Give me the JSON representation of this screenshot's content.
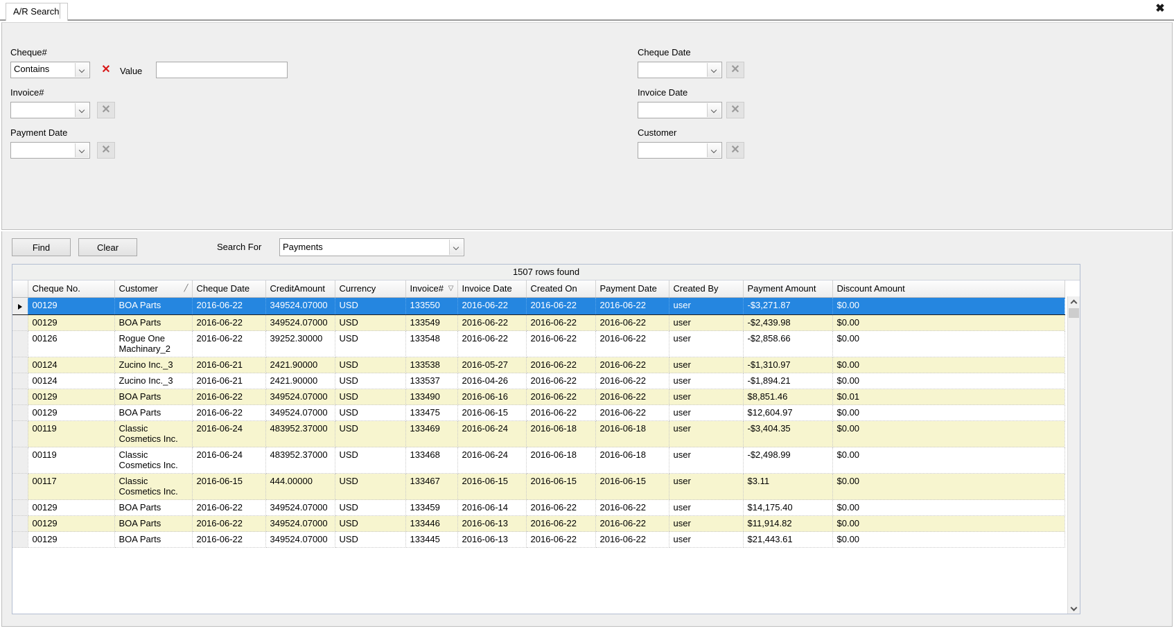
{
  "window": {
    "tab_label": "A/R Search",
    "close_icon": "close-icon",
    "close_glyph": "✖"
  },
  "criteria": {
    "cheque_no": {
      "label": "Cheque#",
      "operator_value": "Contains",
      "clear_glyph": "✕",
      "value_label": "Value",
      "value_text": "",
      "value_placeholder": ""
    },
    "invoice_no": {
      "label": "Invoice#",
      "operator_value": "",
      "clear_glyph": "✕"
    },
    "payment_date": {
      "label": "Payment Date",
      "operator_value": "",
      "clear_glyph": "✕"
    },
    "cheque_date": {
      "label": "Cheque Date",
      "operator_value": "",
      "clear_glyph": "✕"
    },
    "invoice_date": {
      "label": "Invoice Date",
      "operator_value": "",
      "clear_glyph": "✕"
    },
    "customer": {
      "label": "Customer",
      "operator_value": "",
      "clear_glyph": "✕"
    }
  },
  "actions": {
    "find_label": "Find",
    "clear_label": "Clear",
    "search_for_label": "Search For",
    "search_for_value": "Payments"
  },
  "grid": {
    "rows_found_text": "1507 rows found",
    "columns": [
      {
        "label": "Cheque No.",
        "sort": ""
      },
      {
        "label": "Customer",
        "sort": "╱"
      },
      {
        "label": "Cheque Date",
        "sort": ""
      },
      {
        "label": "CreditAmount",
        "sort": ""
      },
      {
        "label": "Currency",
        "sort": ""
      },
      {
        "label": "Invoice#",
        "sort": "▽"
      },
      {
        "label": "Invoice Date",
        "sort": ""
      },
      {
        "label": "Created On",
        "sort": ""
      },
      {
        "label": "Payment Date",
        "sort": ""
      },
      {
        "label": "Created By",
        "sort": ""
      },
      {
        "label": "Payment Amount",
        "sort": ""
      },
      {
        "label": "Discount Amount",
        "sort": ""
      }
    ],
    "rows": [
      {
        "selected": true,
        "cheque_no": "00129",
        "customer": "BOA Parts",
        "cheque_date": "2016-06-22",
        "credit_amount": "349524.07000",
        "currency": "USD",
        "invoice_no": "133550",
        "invoice_date": "2016-06-22",
        "created_on": "2016-06-22",
        "payment_date": "2016-06-22",
        "created_by": "user",
        "payment_amount": "-$3,271.87",
        "discount_amount": "$0.00"
      },
      {
        "selected": false,
        "cheque_no": "00129",
        "customer": "BOA Parts",
        "cheque_date": "2016-06-22",
        "credit_amount": "349524.07000",
        "currency": "USD",
        "invoice_no": "133549",
        "invoice_date": "2016-06-22",
        "created_on": "2016-06-22",
        "payment_date": "2016-06-22",
        "created_by": "user",
        "payment_amount": "-$2,439.98",
        "discount_amount": "$0.00"
      },
      {
        "selected": false,
        "cheque_no": "00126",
        "customer": "Rogue One Machinary_2",
        "cheque_date": "2016-06-22",
        "credit_amount": "39252.30000",
        "currency": "USD",
        "invoice_no": "133548",
        "invoice_date": "2016-06-22",
        "created_on": "2016-06-22",
        "payment_date": "2016-06-22",
        "created_by": "user",
        "payment_amount": "-$2,858.66",
        "discount_amount": "$0.00"
      },
      {
        "selected": false,
        "cheque_no": "00124",
        "customer": "Zucino Inc._3",
        "cheque_date": "2016-06-21",
        "credit_amount": "2421.90000",
        "currency": "USD",
        "invoice_no": "133538",
        "invoice_date": "2016-05-27",
        "created_on": "2016-06-22",
        "payment_date": "2016-06-22",
        "created_by": "user",
        "payment_amount": "-$1,310.97",
        "discount_amount": "$0.00"
      },
      {
        "selected": false,
        "cheque_no": "00124",
        "customer": "Zucino Inc._3",
        "cheque_date": "2016-06-21",
        "credit_amount": "2421.90000",
        "currency": "USD",
        "invoice_no": "133537",
        "invoice_date": "2016-04-26",
        "created_on": "2016-06-22",
        "payment_date": "2016-06-22",
        "created_by": "user",
        "payment_amount": "-$1,894.21",
        "discount_amount": "$0.00"
      },
      {
        "selected": false,
        "cheque_no": "00129",
        "customer": "BOA Parts",
        "cheque_date": "2016-06-22",
        "credit_amount": "349524.07000",
        "currency": "USD",
        "invoice_no": "133490",
        "invoice_date": "2016-06-16",
        "created_on": "2016-06-22",
        "payment_date": "2016-06-22",
        "created_by": "user",
        "payment_amount": "$8,851.46",
        "discount_amount": "$0.01"
      },
      {
        "selected": false,
        "cheque_no": "00129",
        "customer": "BOA Parts",
        "cheque_date": "2016-06-22",
        "credit_amount": "349524.07000",
        "currency": "USD",
        "invoice_no": "133475",
        "invoice_date": "2016-06-15",
        "created_on": "2016-06-22",
        "payment_date": "2016-06-22",
        "created_by": "user",
        "payment_amount": "$12,604.97",
        "discount_amount": "$0.00"
      },
      {
        "selected": false,
        "cheque_no": "00119",
        "customer": "Classic Cosmetics Inc.",
        "cheque_date": "2016-06-24",
        "credit_amount": "483952.37000",
        "currency": "USD",
        "invoice_no": "133469",
        "invoice_date": "2016-06-24",
        "created_on": "2016-06-18",
        "payment_date": "2016-06-18",
        "created_by": "user",
        "payment_amount": "-$3,404.35",
        "discount_amount": "$0.00"
      },
      {
        "selected": false,
        "cheque_no": "00119",
        "customer": "Classic Cosmetics Inc.",
        "cheque_date": "2016-06-24",
        "credit_amount": "483952.37000",
        "currency": "USD",
        "invoice_no": "133468",
        "invoice_date": "2016-06-24",
        "created_on": "2016-06-18",
        "payment_date": "2016-06-18",
        "created_by": "user",
        "payment_amount": "-$2,498.99",
        "discount_amount": "$0.00"
      },
      {
        "selected": false,
        "cheque_no": "00117",
        "customer": "Classic Cosmetics Inc.",
        "cheque_date": "2016-06-15",
        "credit_amount": "444.00000",
        "currency": "USD",
        "invoice_no": "133467",
        "invoice_date": "2016-06-15",
        "created_on": "2016-06-15",
        "payment_date": "2016-06-15",
        "created_by": "user",
        "payment_amount": "$3.11",
        "discount_amount": "$0.00"
      },
      {
        "selected": false,
        "cheque_no": "00129",
        "customer": "BOA Parts",
        "cheque_date": "2016-06-22",
        "credit_amount": "349524.07000",
        "currency": "USD",
        "invoice_no": "133459",
        "invoice_date": "2016-06-14",
        "created_on": "2016-06-22",
        "payment_date": "2016-06-22",
        "created_by": "user",
        "payment_amount": "$14,175.40",
        "discount_amount": "$0.00"
      },
      {
        "selected": false,
        "cheque_no": "00129",
        "customer": "BOA Parts",
        "cheque_date": "2016-06-22",
        "credit_amount": "349524.07000",
        "currency": "USD",
        "invoice_no": "133446",
        "invoice_date": "2016-06-13",
        "created_on": "2016-06-22",
        "payment_date": "2016-06-22",
        "created_by": "user",
        "payment_amount": "$11,914.82",
        "discount_amount": "$0.00"
      },
      {
        "selected": false,
        "cheque_no": "00129",
        "customer": "BOA Parts",
        "cheque_date": "2016-06-22",
        "credit_amount": "349524.07000",
        "currency": "USD",
        "invoice_no": "133445",
        "invoice_date": "2016-06-13",
        "created_on": "2016-06-22",
        "payment_date": "2016-06-22",
        "created_by": "user",
        "payment_amount": "$21,443.61",
        "discount_amount": "$0.00"
      }
    ]
  },
  "colors": {
    "selection_blue": "#2586e0",
    "alt_row_yellow": "#f7f5cf",
    "panel_gray": "#efefef",
    "clear_red": "#d81818"
  }
}
